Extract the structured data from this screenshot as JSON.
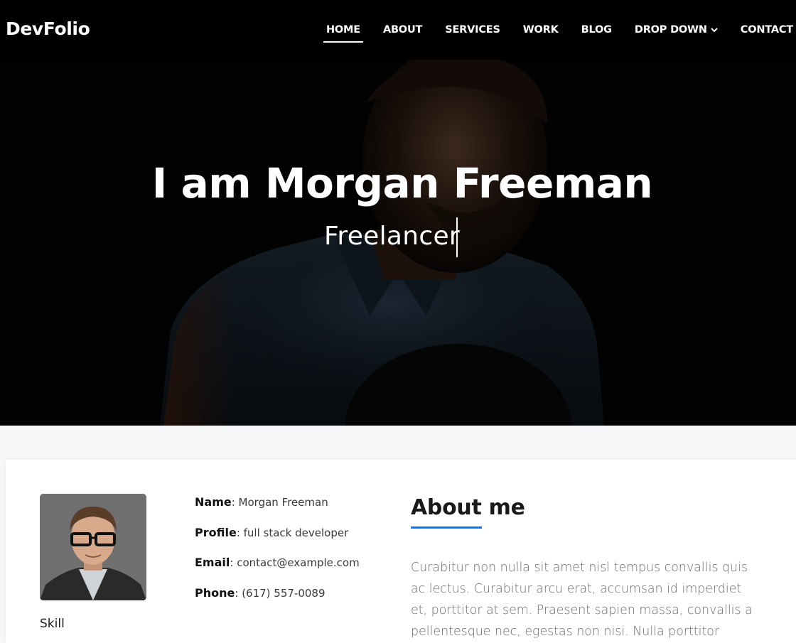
{
  "brand": {
    "logo": "DevFolio"
  },
  "nav": {
    "items": [
      {
        "label": "HOME",
        "active": true
      },
      {
        "label": "ABOUT"
      },
      {
        "label": "SERVICES"
      },
      {
        "label": "WORK"
      },
      {
        "label": "BLOG"
      },
      {
        "label": "DROP DOWN",
        "icon": "chevron-down-icon"
      },
      {
        "label": "CONTACT"
      }
    ]
  },
  "hero": {
    "title": "I am Morgan Freeman",
    "typed_text": "Freelancer"
  },
  "about": {
    "info": [
      {
        "key": "Name",
        "value": "Morgan Freeman"
      },
      {
        "key": "Profile",
        "value": "full stack developer"
      },
      {
        "key": "Email",
        "value": "contact@example.com"
      },
      {
        "key": "Phone",
        "value": "(617) 557-0089"
      }
    ],
    "skill_heading": "Skill",
    "title": "About me",
    "paragraph": "Curabitur non nulla sit amet nisl tempus convallis quis ac lectus. Curabitur arcu erat, accumsan id imperdiet et, porttitor at sem. Praesent sapien massa, convallis a pellentesque nec, egestas non nisi. Nulla porttitor"
  },
  "colors": {
    "accent": "#0078ff",
    "header_bg": "#000000",
    "section_bg": "#f5f7f9"
  }
}
